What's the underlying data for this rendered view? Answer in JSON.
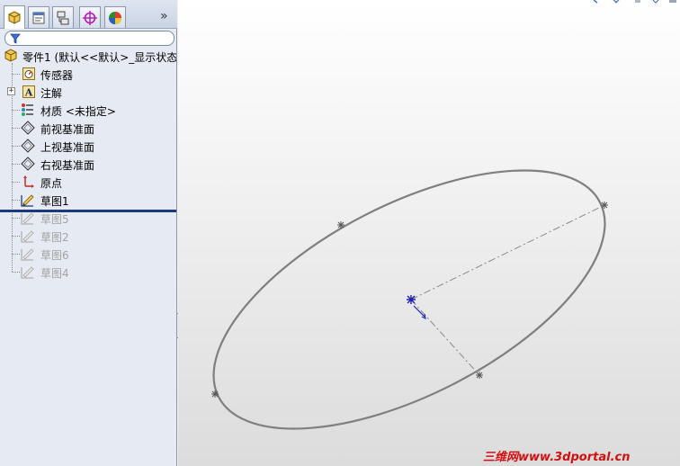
{
  "feature_manager": {
    "tabs": [
      {
        "name": "featuremanager-tab",
        "icon": "feature-tree-icon",
        "active": true
      },
      {
        "name": "propertymanager-tab",
        "icon": "property-manager-icon",
        "active": false
      },
      {
        "name": "configurationmanager-tab",
        "icon": "configuration-manager-icon",
        "active": false
      },
      {
        "name": "dimxpert-tab",
        "icon": "dimxpert-crosshair-icon",
        "active": false
      },
      {
        "name": "display-manager-tab",
        "icon": "appearance-pie-icon",
        "active": false
      }
    ],
    "more_label": "»",
    "filter_icon": "filter-icon",
    "tree": {
      "root_label": "零件1 (默认<<默认>_显示状态",
      "items": [
        {
          "label": "传感器",
          "icon": "sensor-icon",
          "greyed": false
        },
        {
          "label": "注解",
          "icon": "annotation-icon",
          "greyed": false,
          "expandable": true
        },
        {
          "label": "材质 <未指定>",
          "icon": "material-icon",
          "greyed": false
        },
        {
          "label": "前视基准面",
          "icon": "plane-icon",
          "greyed": false
        },
        {
          "label": "上视基准面",
          "icon": "plane-icon",
          "greyed": false
        },
        {
          "label": "右视基准面",
          "icon": "plane-icon",
          "greyed": false
        },
        {
          "label": "原点",
          "icon": "origin-icon",
          "greyed": false
        },
        {
          "label": "草图1",
          "icon": "sketch-icon",
          "greyed": false
        },
        {
          "label": "草图5",
          "icon": "sketch-icon",
          "greyed": true
        },
        {
          "label": "草图2",
          "icon": "sketch-icon",
          "greyed": true
        },
        {
          "label": "草图6",
          "icon": "sketch-icon",
          "greyed": true
        },
        {
          "label": "草图4",
          "icon": "sketch-icon",
          "greyed": true
        }
      ]
    }
  },
  "watermark": "三维网www.3dportal.cn",
  "colors": {
    "ellipse_stroke": "#7f7f7f",
    "axis_line": "#8a8a8a",
    "center_point": "#1f1fb0",
    "watermark": "#d11010",
    "rollback_bar": "#1b3a7a"
  }
}
